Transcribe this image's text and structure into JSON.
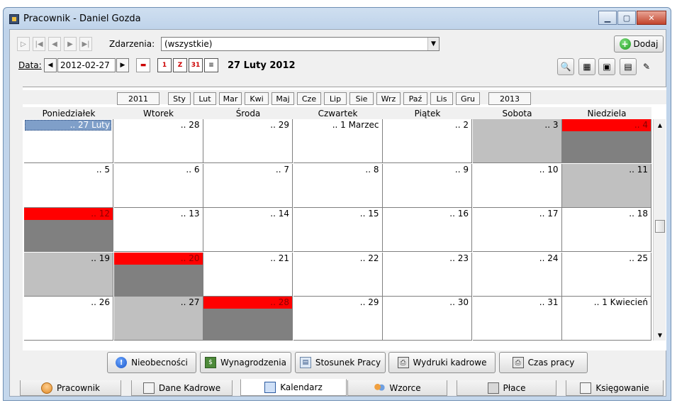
{
  "window": {
    "title": "Pracownik - Daniel Gozda"
  },
  "toolbar": {
    "events_label": "Zdarzenia:",
    "events_value": "(wszystkie)",
    "add_label": "Dodaj",
    "date_label": "Data:",
    "date_value": "2012-02-27",
    "current_date_display": "27 Luty 2012"
  },
  "icons": {
    "calendar_day": "1",
    "calendar_z": "Z",
    "calendar_month": "31",
    "calendar_list": "≡"
  },
  "months": {
    "prev_year": "2011",
    "next_year": "2013",
    "items": [
      "Sty",
      "Lut",
      "Mar",
      "Kwi",
      "Maj",
      "Cze",
      "Lip",
      "Sie",
      "Wrz",
      "Paź",
      "Lis",
      "Gru"
    ]
  },
  "weekdays": [
    "Poniedziałek",
    "Wtorek",
    "Środa",
    "Czwartek",
    "Piątek",
    "Sobota",
    "Niedziela"
  ],
  "weeks": [
    [
      ".. 27 Luty",
      ".. 28",
      ".. 29",
      ".. 1 Marzec",
      ".. 2",
      ".. 3",
      ".. 4"
    ],
    [
      ".. 5",
      ".. 6",
      ".. 7",
      ".. 8",
      ".. 9",
      ".. 10",
      ".. 11"
    ],
    [
      ".. 12",
      ".. 13",
      ".. 14",
      ".. 15",
      ".. 16",
      ".. 17",
      ".. 18"
    ],
    [
      ".. 19",
      ".. 20",
      ".. 21",
      ".. 22",
      ".. 23",
      ".. 24",
      ".. 25"
    ],
    [
      ".. 26",
      ".. 27",
      ".. 28",
      ".. 29",
      ".. 30",
      ".. 31",
      ".. 1 Kwiecień"
    ]
  ],
  "cell_types": [
    [
      "selected",
      "normal",
      "normal",
      "normal",
      "normal",
      "weekend",
      "holiday"
    ],
    [
      "normal",
      "normal",
      "normal",
      "normal",
      "normal",
      "normal",
      "weekend"
    ],
    [
      "holiday",
      "normal",
      "normal",
      "normal",
      "normal",
      "normal",
      "normal"
    ],
    [
      "weekend",
      "holiday",
      "normal",
      "normal",
      "normal",
      "normal",
      "normal"
    ],
    [
      "normal",
      "weekend",
      "holiday",
      "normal",
      "normal",
      "normal",
      "normal"
    ]
  ],
  "colors": {
    "holiday": "#ff0000",
    "holiday_fill": "#808080",
    "weekend": "#c0c0c0",
    "selected": "#7f9fc9"
  },
  "actions": {
    "absences": "Nieobecności",
    "salaries": "Wynagrodzenia",
    "employment": "Stosunek Pracy",
    "hr_prints": "Wydruki kadrowe",
    "work_time": "Czas pracy"
  },
  "tabs": [
    "Pracownik",
    "Dane Kadrowe",
    "Kalendarz",
    "Wzorce",
    "Płace",
    "Księgowanie"
  ],
  "tab_active": "Kalendarz"
}
